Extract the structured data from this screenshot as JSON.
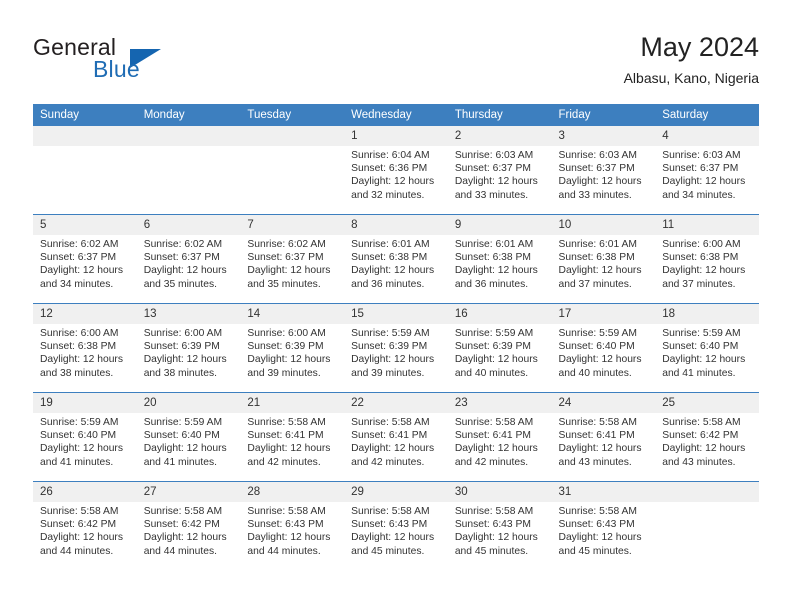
{
  "brand": {
    "name_part1": "General",
    "name_part2": "Blue",
    "triangle_icon": "brand-triangle-icon",
    "accent_color": "#1565b0"
  },
  "header": {
    "title": "May 2024",
    "location": "Albasu, Kano, Nigeria"
  },
  "theme": {
    "header_blue": "#3d7fbf",
    "daynum_band": "#f0f0f0",
    "text": "#333333"
  },
  "weekday_headers": [
    "Sunday",
    "Monday",
    "Tuesday",
    "Wednesday",
    "Thursday",
    "Friday",
    "Saturday"
  ],
  "labels": {
    "sunrise": "Sunrise:",
    "sunset": "Sunset:",
    "daylight": "Daylight:"
  },
  "weeks": [
    [
      {
        "day": "",
        "sunrise": "",
        "sunset": "",
        "daylight": ""
      },
      {
        "day": "",
        "sunrise": "",
        "sunset": "",
        "daylight": ""
      },
      {
        "day": "",
        "sunrise": "",
        "sunset": "",
        "daylight": ""
      },
      {
        "day": "1",
        "sunrise": "Sunrise: 6:04 AM",
        "sunset": "Sunset: 6:36 PM",
        "daylight": "Daylight: 12 hours and 32 minutes."
      },
      {
        "day": "2",
        "sunrise": "Sunrise: 6:03 AM",
        "sunset": "Sunset: 6:37 PM",
        "daylight": "Daylight: 12 hours and 33 minutes."
      },
      {
        "day": "3",
        "sunrise": "Sunrise: 6:03 AM",
        "sunset": "Sunset: 6:37 PM",
        "daylight": "Daylight: 12 hours and 33 minutes."
      },
      {
        "day": "4",
        "sunrise": "Sunrise: 6:03 AM",
        "sunset": "Sunset: 6:37 PM",
        "daylight": "Daylight: 12 hours and 34 minutes."
      }
    ],
    [
      {
        "day": "5",
        "sunrise": "Sunrise: 6:02 AM",
        "sunset": "Sunset: 6:37 PM",
        "daylight": "Daylight: 12 hours and 34 minutes."
      },
      {
        "day": "6",
        "sunrise": "Sunrise: 6:02 AM",
        "sunset": "Sunset: 6:37 PM",
        "daylight": "Daylight: 12 hours and 35 minutes."
      },
      {
        "day": "7",
        "sunrise": "Sunrise: 6:02 AM",
        "sunset": "Sunset: 6:37 PM",
        "daylight": "Daylight: 12 hours and 35 minutes."
      },
      {
        "day": "8",
        "sunrise": "Sunrise: 6:01 AM",
        "sunset": "Sunset: 6:38 PM",
        "daylight": "Daylight: 12 hours and 36 minutes."
      },
      {
        "day": "9",
        "sunrise": "Sunrise: 6:01 AM",
        "sunset": "Sunset: 6:38 PM",
        "daylight": "Daylight: 12 hours and 36 minutes."
      },
      {
        "day": "10",
        "sunrise": "Sunrise: 6:01 AM",
        "sunset": "Sunset: 6:38 PM",
        "daylight": "Daylight: 12 hours and 37 minutes."
      },
      {
        "day": "11",
        "sunrise": "Sunrise: 6:00 AM",
        "sunset": "Sunset: 6:38 PM",
        "daylight": "Daylight: 12 hours and 37 minutes."
      }
    ],
    [
      {
        "day": "12",
        "sunrise": "Sunrise: 6:00 AM",
        "sunset": "Sunset: 6:38 PM",
        "daylight": "Daylight: 12 hours and 38 minutes."
      },
      {
        "day": "13",
        "sunrise": "Sunrise: 6:00 AM",
        "sunset": "Sunset: 6:39 PM",
        "daylight": "Daylight: 12 hours and 38 minutes."
      },
      {
        "day": "14",
        "sunrise": "Sunrise: 6:00 AM",
        "sunset": "Sunset: 6:39 PM",
        "daylight": "Daylight: 12 hours and 39 minutes."
      },
      {
        "day": "15",
        "sunrise": "Sunrise: 5:59 AM",
        "sunset": "Sunset: 6:39 PM",
        "daylight": "Daylight: 12 hours and 39 minutes."
      },
      {
        "day": "16",
        "sunrise": "Sunrise: 5:59 AM",
        "sunset": "Sunset: 6:39 PM",
        "daylight": "Daylight: 12 hours and 40 minutes."
      },
      {
        "day": "17",
        "sunrise": "Sunrise: 5:59 AM",
        "sunset": "Sunset: 6:40 PM",
        "daylight": "Daylight: 12 hours and 40 minutes."
      },
      {
        "day": "18",
        "sunrise": "Sunrise: 5:59 AM",
        "sunset": "Sunset: 6:40 PM",
        "daylight": "Daylight: 12 hours and 41 minutes."
      }
    ],
    [
      {
        "day": "19",
        "sunrise": "Sunrise: 5:59 AM",
        "sunset": "Sunset: 6:40 PM",
        "daylight": "Daylight: 12 hours and 41 minutes."
      },
      {
        "day": "20",
        "sunrise": "Sunrise: 5:59 AM",
        "sunset": "Sunset: 6:40 PM",
        "daylight": "Daylight: 12 hours and 41 minutes."
      },
      {
        "day": "21",
        "sunrise": "Sunrise: 5:58 AM",
        "sunset": "Sunset: 6:41 PM",
        "daylight": "Daylight: 12 hours and 42 minutes."
      },
      {
        "day": "22",
        "sunrise": "Sunrise: 5:58 AM",
        "sunset": "Sunset: 6:41 PM",
        "daylight": "Daylight: 12 hours and 42 minutes."
      },
      {
        "day": "23",
        "sunrise": "Sunrise: 5:58 AM",
        "sunset": "Sunset: 6:41 PM",
        "daylight": "Daylight: 12 hours and 42 minutes."
      },
      {
        "day": "24",
        "sunrise": "Sunrise: 5:58 AM",
        "sunset": "Sunset: 6:41 PM",
        "daylight": "Daylight: 12 hours and 43 minutes."
      },
      {
        "day": "25",
        "sunrise": "Sunrise: 5:58 AM",
        "sunset": "Sunset: 6:42 PM",
        "daylight": "Daylight: 12 hours and 43 minutes."
      }
    ],
    [
      {
        "day": "26",
        "sunrise": "Sunrise: 5:58 AM",
        "sunset": "Sunset: 6:42 PM",
        "daylight": "Daylight: 12 hours and 44 minutes."
      },
      {
        "day": "27",
        "sunrise": "Sunrise: 5:58 AM",
        "sunset": "Sunset: 6:42 PM",
        "daylight": "Daylight: 12 hours and 44 minutes."
      },
      {
        "day": "28",
        "sunrise": "Sunrise: 5:58 AM",
        "sunset": "Sunset: 6:43 PM",
        "daylight": "Daylight: 12 hours and 44 minutes."
      },
      {
        "day": "29",
        "sunrise": "Sunrise: 5:58 AM",
        "sunset": "Sunset: 6:43 PM",
        "daylight": "Daylight: 12 hours and 45 minutes."
      },
      {
        "day": "30",
        "sunrise": "Sunrise: 5:58 AM",
        "sunset": "Sunset: 6:43 PM",
        "daylight": "Daylight: 12 hours and 45 minutes."
      },
      {
        "day": "31",
        "sunrise": "Sunrise: 5:58 AM",
        "sunset": "Sunset: 6:43 PM",
        "daylight": "Daylight: 12 hours and 45 minutes."
      },
      {
        "day": "",
        "sunrise": "",
        "sunset": "",
        "daylight": ""
      }
    ]
  ]
}
